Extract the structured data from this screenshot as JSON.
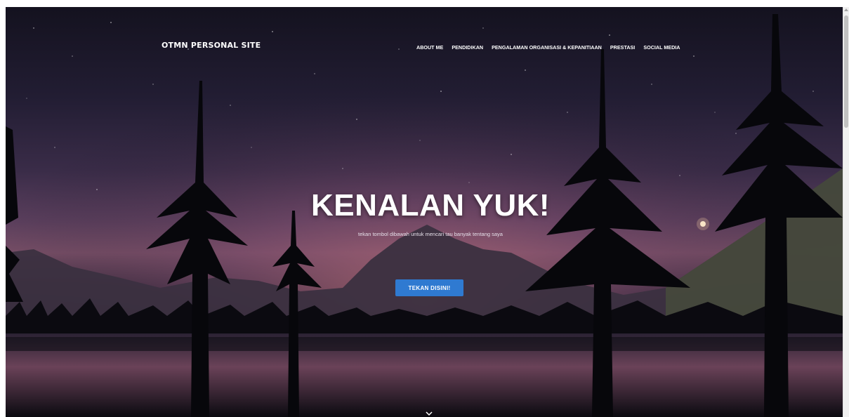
{
  "site": {
    "brand": "OTMN PERSONAL SITE"
  },
  "nav": {
    "items": [
      {
        "label": "ABOUT ME"
      },
      {
        "label": "PENDIDIKAN"
      },
      {
        "label": "PENGALAMAN ORGANISASI & KEPANITIAAN"
      },
      {
        "label": "PRESTASI"
      },
      {
        "label": "SOCIAL MEDIA"
      }
    ]
  },
  "hero": {
    "title": "KENALAN YUK!",
    "subtitle": "tekan tombol dibawah untuk mencari tau banyak tentang saya",
    "button_label": "TEKAN DISINI!"
  },
  "icons": {
    "scroll_down": "chevron-down-icon"
  },
  "colors": {
    "button": "#2f7ad1",
    "text": "#ffffff"
  }
}
